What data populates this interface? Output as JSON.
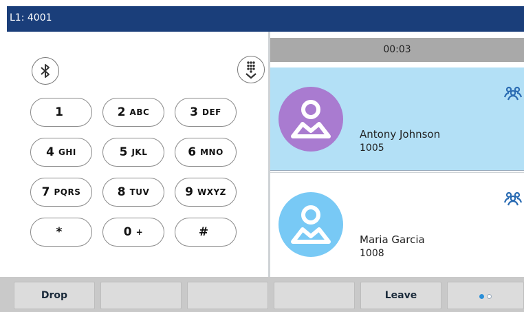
{
  "header": {
    "line_label": "L1: 4001"
  },
  "dialpad": {
    "keys": [
      {
        "digit": "1",
        "letters": ""
      },
      {
        "digit": "2",
        "letters": "ABC"
      },
      {
        "digit": "3",
        "letters": "DEF"
      },
      {
        "digit": "4",
        "letters": "GHI"
      },
      {
        "digit": "5",
        "letters": "JKL"
      },
      {
        "digit": "6",
        "letters": "MNO"
      },
      {
        "digit": "7",
        "letters": "PQRS"
      },
      {
        "digit": "8",
        "letters": "TUV"
      },
      {
        "digit": "9",
        "letters": "WXYZ"
      },
      {
        "digit": "*",
        "letters": ""
      },
      {
        "digit": "0",
        "letters": "+"
      },
      {
        "digit": "#",
        "letters": ""
      }
    ],
    "icons": [
      "bluetooth-icon",
      "hide-dialpad-icon"
    ]
  },
  "call": {
    "timer": "00:03",
    "participants": [
      {
        "name": "Antony Johnson",
        "number": "1005",
        "avatar_color": "#a97bd0",
        "active": true
      },
      {
        "name": "Maria Garcia",
        "number": "1008",
        "avatar_color": "#78c9f5",
        "active": false
      }
    ]
  },
  "softkeys": [
    {
      "label": "Drop"
    },
    {
      "label": ""
    },
    {
      "label": ""
    },
    {
      "label": ""
    },
    {
      "label": "Leave"
    },
    {
      "label": "",
      "page_indicator": "page 1 of 2"
    }
  ],
  "colors": {
    "titlebar": "#1a3e7a",
    "active_row": "#b3e0f6",
    "conference_icon": "#2b6cb3"
  }
}
